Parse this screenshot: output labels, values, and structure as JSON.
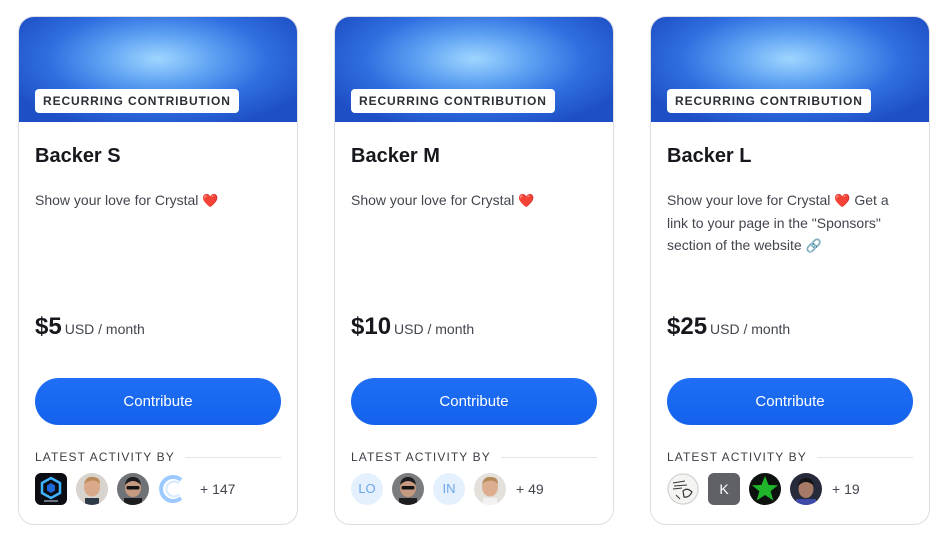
{
  "tiers": [
    {
      "tag": "RECURRING CONTRIBUTION",
      "title": "Backer S",
      "desc_text": "Show your love for Crystal",
      "desc_icon": "heart-icon",
      "amount": "$5",
      "unit": "USD / month",
      "button_label": "Contribute",
      "activity_label": "LATEST ACTIVITY BY",
      "more_count": "+ 147",
      "avatars": [
        "hex-logo",
        "photo-blond-man",
        "photo-man-sunglasses",
        "ring-logo"
      ]
    },
    {
      "tag": "RECURRING CONTRIBUTION",
      "title": "Backer M",
      "desc_text": "Show your love for Crystal",
      "desc_icon": "heart-icon",
      "amount": "$10",
      "unit": "USD / month",
      "button_label": "Contribute",
      "activity_label": "LATEST ACTIVITY BY",
      "more_count": "+ 49",
      "initials": [
        "LO",
        "IN"
      ],
      "avatars": [
        "initials-LO",
        "photo-man-sunglasses",
        "initials-IN",
        "photo-blond-man"
      ]
    },
    {
      "tag": "RECURRING CONTRIBUTION",
      "title": "Backer L",
      "desc_text": "Show your love for Crystal",
      "desc_icon": "heart-icon",
      "desc_text_2": "Get a link to your page in the \"Sponsors\" section of the website",
      "desc_icon_2": "link-icon",
      "amount": "$25",
      "unit": "USD / month",
      "button_label": "Contribute",
      "activity_label": "LATEST ACTIVITY BY",
      "more_count": "+ 19",
      "k_initial": "K",
      "avatars": [
        "sketch-drawing",
        "initial-K",
        "green-star",
        "photo-man-dark"
      ]
    }
  ],
  "colors": {
    "accent": "#1462ec",
    "banner_center": "#9fd6ff",
    "banner_edge": "#1e4fc4",
    "heart": "#e8436e"
  }
}
